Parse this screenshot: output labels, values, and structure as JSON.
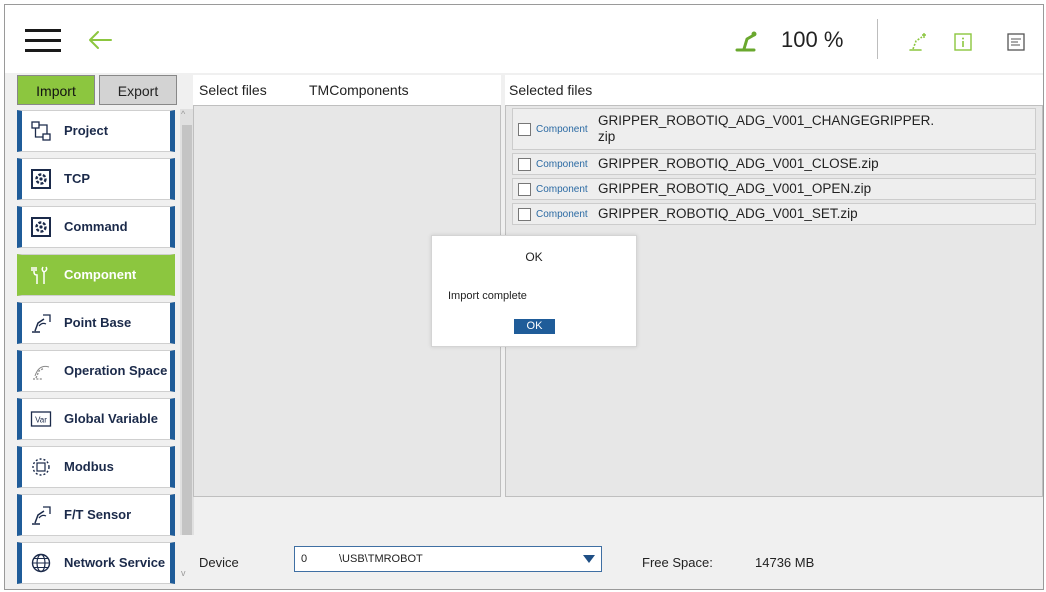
{
  "topbar": {
    "speed": "100 %",
    "icons": [
      "menu-icon",
      "back-arrow-icon",
      "robot-arm-icon",
      "robot-status-icon",
      "info-icon",
      "document-icon"
    ],
    "accent": "#8cc63f"
  },
  "sidebar": {
    "tabs": [
      {
        "label": "Import"
      },
      {
        "label": "Export"
      }
    ],
    "items": [
      {
        "label": "Project",
        "icon": "project-icon"
      },
      {
        "label": "TCP",
        "icon": "tcp-icon"
      },
      {
        "label": "Command",
        "icon": "command-icon"
      },
      {
        "label": "Component",
        "icon": "component-icon",
        "active": true
      },
      {
        "label": "Point Base",
        "icon": "point-base-icon"
      },
      {
        "label": "Operation Space",
        "icon": "operation-space-icon"
      },
      {
        "label": "Global Variable",
        "icon": "global-variable-icon"
      },
      {
        "label": "Modbus",
        "icon": "modbus-icon"
      },
      {
        "label": "F/T Sensor",
        "icon": "ft-sensor-icon"
      },
      {
        "label": "Network Service",
        "icon": "network-service-icon"
      }
    ],
    "icon_var_text": "Var",
    "active_color": "#8cc63f",
    "border_color": "#1f5c99"
  },
  "left_panel": {
    "header_select": "Select files",
    "header_path": "TMComponents"
  },
  "right_panel": {
    "header": "Selected files",
    "files": [
      {
        "tag": "Component",
        "name": "GRIPPER_ROBOTIQ_ADG_V001_CHANGEGRIPPER.",
        "name2": "zip"
      },
      {
        "tag": "Component",
        "name": "GRIPPER_ROBOTIQ_ADG_V001_CLOSE.zip"
      },
      {
        "tag": "Component",
        "name": "GRIPPER_ROBOTIQ_ADG_V001_OPEN.zip"
      },
      {
        "tag": "Component",
        "name": "GRIPPER_ROBOTIQ_ADG_V001_SET.zip"
      }
    ]
  },
  "bottom": {
    "device_label": "Device",
    "device_index": "0",
    "device_path": "\\USB\\TMROBOT",
    "free_space_label": "Free Space:",
    "free_space_value": "14736 MB"
  },
  "dialog": {
    "title": "OK",
    "message": "Import complete",
    "button": "OK"
  }
}
